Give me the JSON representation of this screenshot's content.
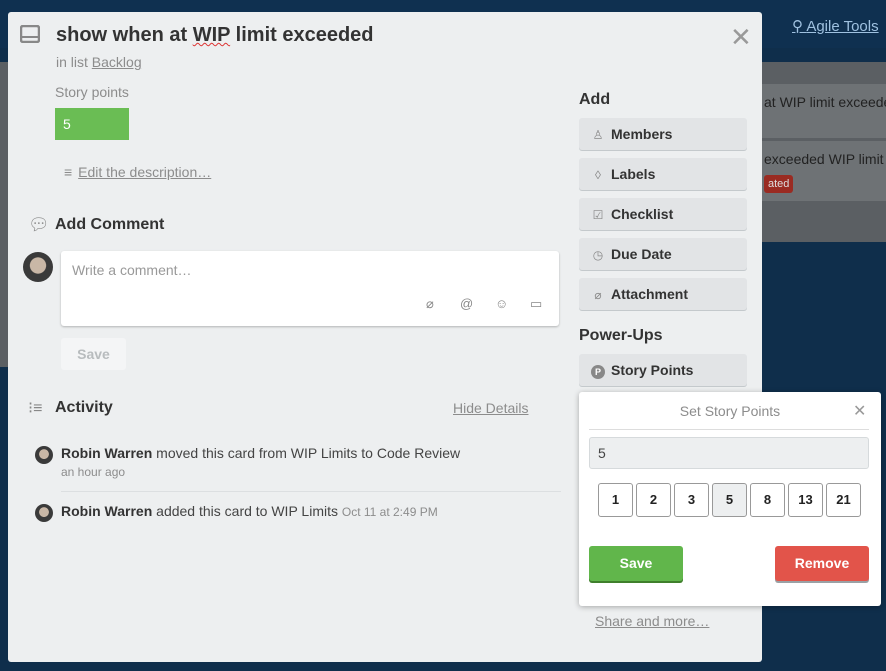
{
  "background": {
    "header_link": "Agile Tools",
    "cards": [
      {
        "text": "at WIP limit exceeded"
      },
      {
        "text": "exceeded WIP limit",
        "badge": "ated"
      }
    ]
  },
  "card": {
    "title_pre": "show when at ",
    "title_wip": "WIP",
    "title_post": " limit exceeded",
    "in_list_prefix": "in list",
    "list_name": "Backlog",
    "story_points_label": "Story points",
    "story_points_value": "5",
    "edit_description": "Edit the description…"
  },
  "comment": {
    "heading": "Add Comment",
    "placeholder": "Write a comment…",
    "save": "Save"
  },
  "activity": {
    "heading": "Activity",
    "hide_details": "Hide Details",
    "items": [
      {
        "user": "Robin Warren",
        "action": "moved this card from WIP Limits to Code Review",
        "time": "an hour ago"
      },
      {
        "user": "Robin Warren",
        "action": "added this card to WIP Limits",
        "time": "Oct 11 at 2:49 PM"
      }
    ]
  },
  "sidebar": {
    "add_heading": "Add",
    "add_buttons": [
      {
        "label": "Members",
        "icon": "person-icon"
      },
      {
        "label": "Labels",
        "icon": "tag-icon"
      },
      {
        "label": "Checklist",
        "icon": "checkbox-icon"
      },
      {
        "label": "Due Date",
        "icon": "clock-icon"
      },
      {
        "label": "Attachment",
        "icon": "paperclip-icon"
      }
    ],
    "powerups_heading": "Power-Ups",
    "story_points_button": "Story Points",
    "share": "Share and more…"
  },
  "popover": {
    "title": "Set Story Points",
    "input_value": "5",
    "options": [
      "1",
      "2",
      "3",
      "5",
      "8",
      "13",
      "21"
    ],
    "selected": "5",
    "save": "Save",
    "remove": "Remove"
  },
  "colors": {
    "green": "#6abd54",
    "save_green": "#61b64b",
    "remove_red": "#e2544a",
    "navy": "#0f2e4b"
  }
}
